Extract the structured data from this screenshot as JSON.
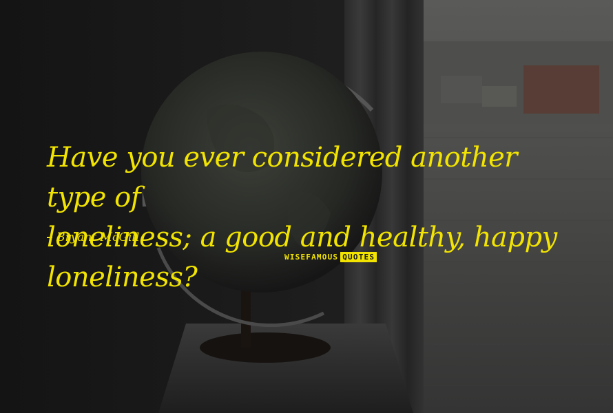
{
  "quote": {
    "lines": [
      "Have you ever considered another type of",
      "loneliness; a good and healthy, happy loneliness?"
    ],
    "author": "Bryant McGill"
  },
  "watermark": {
    "part1": "WISEFAMOUS",
    "part2": "QUOTES",
    "highlight_color": "#f2e400"
  },
  "colors": {
    "text": "#f2e400",
    "background": "#1a1a1a"
  },
  "background_photo": {
    "icon_name": "globe-on-table-by-window"
  }
}
